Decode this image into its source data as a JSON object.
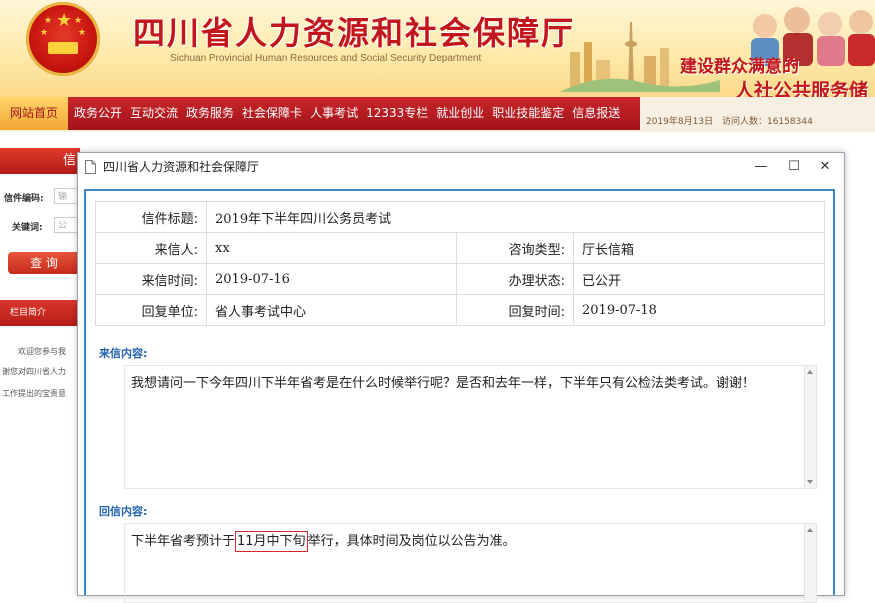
{
  "banner": {
    "title": "四川省人力资源和社会保障厅",
    "subtitle": "Sichuan Provincial Human Resources and Social Security Department",
    "slogan_line1": "建设群众满意的",
    "slogan_line2": "人社公共服务储"
  },
  "nav": {
    "home": "网站首页",
    "items": [
      "政务公开",
      "互动交流",
      "政务服务",
      "社会保障卡",
      "人事考试",
      "12333专栏",
      "就业创业",
      "职业技能鉴定",
      "信息报送"
    ],
    "date": "2019年8月13日",
    "visits_label": "访问人数：",
    "visits": "16158344"
  },
  "sidebar": {
    "header": "信",
    "letter_no_label": "信件编码:",
    "letter_no_placeholder": "输",
    "keyword_label": "关键词:",
    "keyword_placeholder": "公",
    "search_button": "查 询",
    "section_title": "栏目简介",
    "texts": [
      "欢迎您参与我",
      "谢您对四川省人力",
      "工作提出的宝贵意"
    ]
  },
  "dialog": {
    "title": "四川省人力资源和社会保障厅",
    "controls": {
      "minimize": "—",
      "maximize": "☐",
      "close": "✕"
    },
    "info": {
      "subject_label": "信件标题:",
      "subject": "2019年下半年四川公务员考试",
      "sender_label": "来信人:",
      "sender": "xx",
      "category_label": "咨询类型:",
      "category": "厅长信箱",
      "sent_time_label": "来信时间:",
      "sent_time": "2019-07-16",
      "status_label": "办理状态:",
      "status": "已公开",
      "reply_unit_label": "回复单位:",
      "reply_unit": "省人事考试中心",
      "reply_time_label": "回复时间:",
      "reply_time": "2019-07-18"
    },
    "letter_content_label": "来信内容:",
    "letter_content": "我想请问一下今年四川下半年省考是在什么时候举行呢？是否和去年一样，下半年只有公检法类考试。谢谢！",
    "reply_content_label": "回信内容:",
    "reply_before": "下半年省考预计于",
    "reply_highlight": "11月中下旬",
    "reply_after": "举行，具体时间及岗位以公告为准。"
  },
  "colors": {
    "accent_red": "#c3161a",
    "nav_red": "#b51c17",
    "border_blue": "#3e83c4",
    "label_blue": "#2364b0"
  }
}
